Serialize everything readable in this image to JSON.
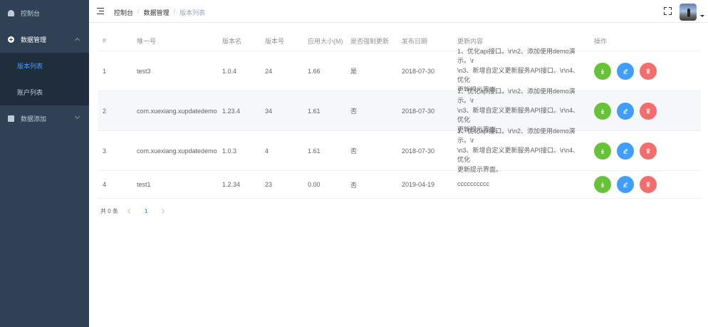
{
  "sidebar": {
    "items": [
      {
        "label": "控制台",
        "icon": "dashboard-icon"
      },
      {
        "label": "数据管理",
        "icon": "plus-circle-icon",
        "expanded": true,
        "children": [
          {
            "label": "版本列表",
            "active": true
          },
          {
            "label": "账户列表",
            "active": false
          }
        ]
      },
      {
        "label": "数据添加",
        "icon": "document-icon",
        "expanded": false
      }
    ],
    "colors": {
      "bg": "#304156",
      "submenu_bg": "#1f2d3d",
      "active": "#409eff"
    }
  },
  "header": {
    "breadcrumb": [
      "控制台",
      "数据管理",
      "版本列表"
    ],
    "separator": "/"
  },
  "table": {
    "columns": [
      "#",
      "唯一号",
      "版本名",
      "版本号",
      "应用大小(M)",
      "是否强制更新",
      "发布日期",
      "更新内容",
      "操作"
    ],
    "rows": [
      {
        "index": "1",
        "uid": "test3",
        "version_name": "1.0.4",
        "version_code": "24",
        "size": "1.66",
        "force": "是",
        "date": "2018-07-30",
        "content": [
          "1、优化api接口。\\r\\n2、添加使用demo演示。\\r",
          "\\n3、新增自定义更新服务API接口。\\r\\n4、优化",
          "更新提示界面。"
        ]
      },
      {
        "index": "2",
        "uid": "com.xuexiang.xupdatedemo",
        "version_name": "1.23.4",
        "version_code": "34",
        "size": "1.61",
        "force": "否",
        "date": "2018-07-30",
        "content": [
          "1、优化api接口。\\r\\n2、添加使用demo演示。\\r",
          "\\n3、新增自定义更新服务API接口。\\r\\n4、优化",
          "更新提示界面。"
        ]
      },
      {
        "index": "3",
        "uid": "com.xuexiang.xupdatedemo",
        "version_name": "1.0.3",
        "version_code": "4",
        "size": "1.61",
        "force": "否",
        "date": "2018-07-30",
        "content": [
          "1、优化api接口。\\r\\n2、添加使用demo演示。\\r",
          "\\n3、新增自定义更新服务API接口。\\r\\n4、优化",
          "更新提示界面。"
        ]
      },
      {
        "index": "4",
        "uid": "test1",
        "version_name": "1.2.34",
        "version_code": "23",
        "size": "0.00",
        "force": "否",
        "date": "2019-04-19",
        "content": [
          "cccccccccc"
        ]
      }
    ],
    "actions": [
      {
        "icon": "download-icon",
        "color": "#67c23a"
      },
      {
        "icon": "edit-icon",
        "color": "#409eff"
      },
      {
        "icon": "delete-icon",
        "color": "#f56c6c"
      }
    ]
  },
  "pagination": {
    "total_label": "共 0 条",
    "current_page": "1"
  }
}
